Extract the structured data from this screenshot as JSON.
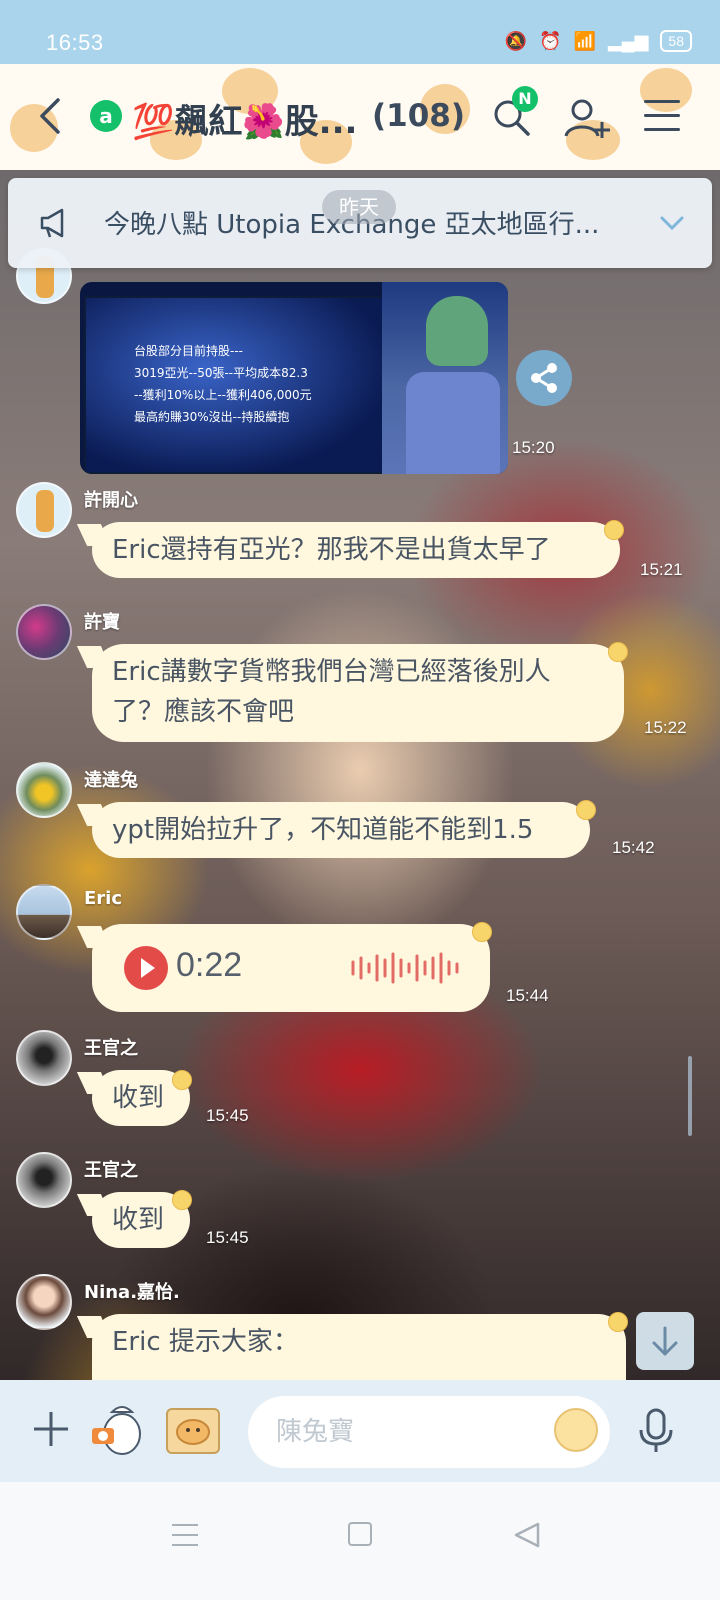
{
  "status_bar": {
    "time": "16:53",
    "battery": "58"
  },
  "header": {
    "title": "💯飆紅🌺股...",
    "member_count": "(108)",
    "notification_badge": "N",
    "icons": [
      "back-icon",
      "group-icon",
      "search-icon",
      "add-friend-icon",
      "menu-icon"
    ]
  },
  "announcement": {
    "text": "今晚八點 Utopia Exchange 亞太地區行..."
  },
  "date_divider": "昨天",
  "image_message": {
    "time": "15:20",
    "screen_lines": [
      "台股部分目前持股---",
      "3019亞光--50張--平均成本82.3",
      "--獲利10%以上--獲利406,000元",
      "最高約賺30%沒出--持股續抱"
    ]
  },
  "messages": [
    {
      "sender": "許開心",
      "text": "Eric還持有亞光？那我不是出貨太早了",
      "time": "15:21"
    },
    {
      "sender": "許寶",
      "text_lines": [
        "Eric講數字貨幣我們台灣已經落後別人",
        "了？應該不會吧"
      ],
      "time": "15:22"
    },
    {
      "sender": "達達兔",
      "text": "ypt開始拉升了，不知道能不能到1.5",
      "time": "15:42"
    },
    {
      "sender": "Eric",
      "voice_duration": "0:22",
      "time": "15:44"
    },
    {
      "sender": "王官之",
      "text": "收到",
      "time": "15:45"
    },
    {
      "sender": "王官之",
      "text": "收到",
      "time": "15:45"
    },
    {
      "sender": "Nina.嘉怡.",
      "text": "Eric 提示大家："
    }
  ],
  "input": {
    "placeholder": "陳兔寶"
  },
  "colors": {
    "status_bar": "#a9d4ec",
    "bubble": "#fff8df",
    "accent_green": "#14c06a",
    "play_red": "#e34b48"
  }
}
